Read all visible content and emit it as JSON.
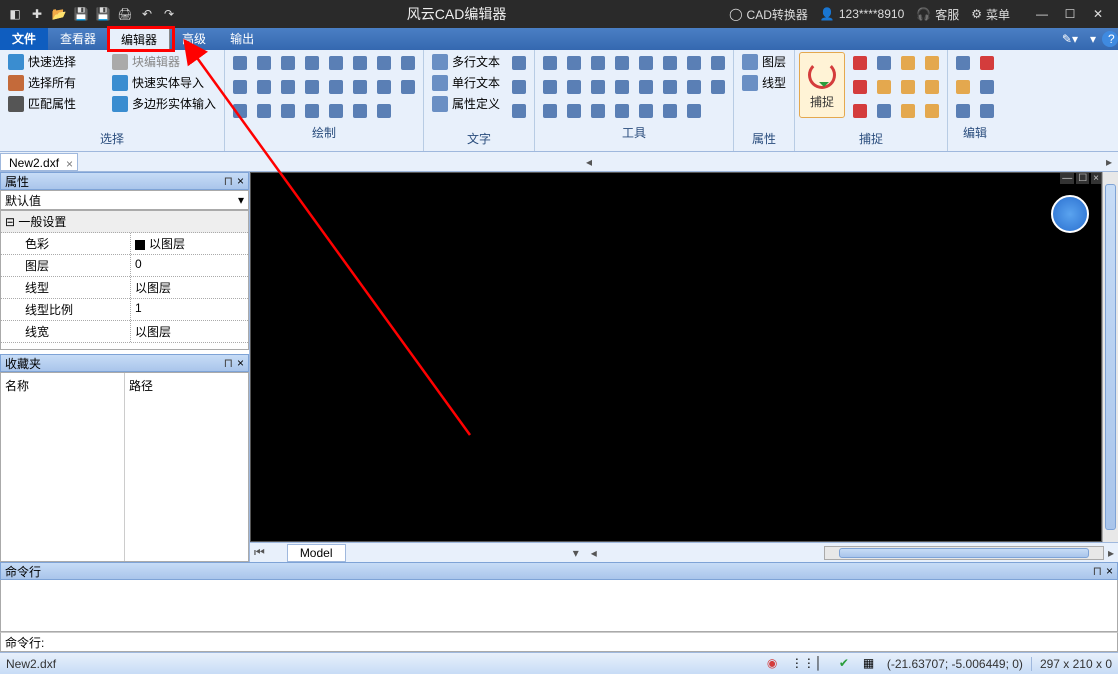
{
  "titlebar": {
    "app_title": "风云CAD编辑器",
    "converter": "CAD转换器",
    "user": "123****8910",
    "support": "客服",
    "menu": "菜单"
  },
  "menubar": {
    "file": "文件",
    "viewer": "查看器",
    "editor": "编辑器",
    "advanced": "高级",
    "output": "输出"
  },
  "ribbon": {
    "select": {
      "label": "选择",
      "quick_select": "快速选择",
      "select_all": "选择所有",
      "match_props": "匹配属性",
      "block_editor": "块编辑器",
      "quick_import": "快速实体导入",
      "polygon_import": "多边形实体输入"
    },
    "draw": {
      "label": "绘制"
    },
    "text": {
      "label": "文字",
      "mtext": "多行文本",
      "stext": "单行文本",
      "attdef": "属性定义"
    },
    "tools": {
      "label": "工具"
    },
    "props": {
      "label": "属性",
      "layer": "图层",
      "linetype": "线型"
    },
    "snap": {
      "label": "捕捉",
      "big": "捕捉"
    },
    "edit": {
      "label": "编辑"
    }
  },
  "doctab": {
    "name": "New2.dxf"
  },
  "properties": {
    "title": "属性",
    "default": "默认值",
    "section_general": "一般设置",
    "rows": [
      {
        "k": "色彩",
        "v": "以图层",
        "sw": true
      },
      {
        "k": "图层",
        "v": "0"
      },
      {
        "k": "线型",
        "v": "以图层"
      },
      {
        "k": "线型比例",
        "v": "1"
      },
      {
        "k": "线宽",
        "v": "以图层"
      }
    ]
  },
  "favorites": {
    "title": "收藏夹",
    "col_name": "名称",
    "col_path": "路径"
  },
  "canvas": {
    "model_tab": "Model"
  },
  "command": {
    "title": "命令行",
    "prompt": "命令行:"
  },
  "status": {
    "filename": "New2.dxf",
    "coords": "(-21.63707; -5.006449; 0)",
    "dims": "297 x 210 x 0"
  }
}
